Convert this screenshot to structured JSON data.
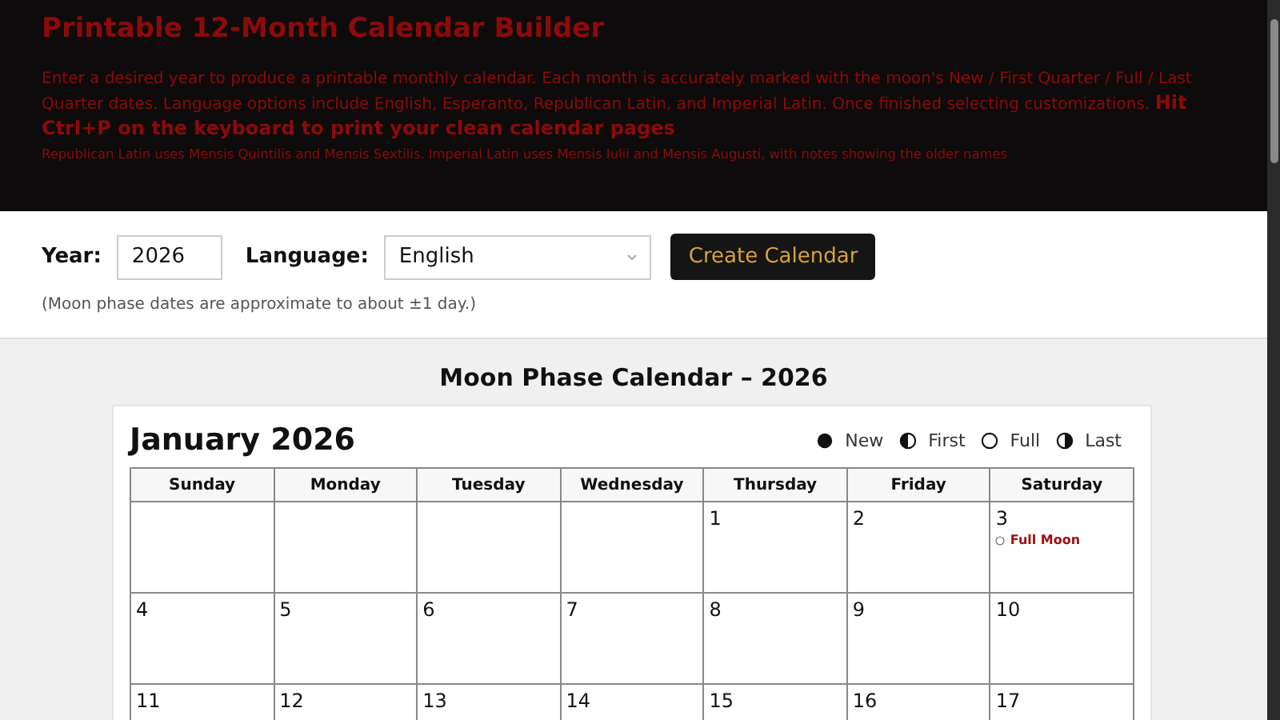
{
  "header": {
    "title": "Printable 12-Month Calendar Builder",
    "intro": "Enter a desired year to produce a printable monthly calendar. Each month is accurately marked with the moon's New / First Quarter / Full / Last Quarter dates. Language options include English, Esperanto, Republican Latin, and Imperial Latin. Once finished selecting customizations.",
    "print_hint": "Hit Ctrl+P on the keyboard to print your clean calendar pages",
    "note": "Republican Latin uses Mensis Quintilis and Mensis Sextilis. Imperial Latin uses Mensis Iulii and Mensis Augusti, with notes showing the older names"
  },
  "controls": {
    "year_label": "Year:",
    "year_value": "2026",
    "language_label": "Language:",
    "language_value": "English",
    "button": "Create Calendar",
    "disclaimer": "(Moon phase dates are approximate to about ±1 day.)"
  },
  "calendar": {
    "heading": "Moon Phase Calendar – 2026",
    "month_title": "January 2026",
    "legend": [
      {
        "kind": "new",
        "label": "New"
      },
      {
        "kind": "first",
        "label": "First"
      },
      {
        "kind": "full",
        "label": "Full"
      },
      {
        "kind": "last",
        "label": "Last"
      }
    ],
    "weekdays": [
      "Sunday",
      "Monday",
      "Tuesday",
      "Wednesday",
      "Thursday",
      "Friday",
      "Saturday"
    ],
    "weeks": [
      [
        {
          "day": "1"
        },
        {
          "day": "2"
        },
        {
          "day": "3",
          "events": [
            {
              "kind": "full",
              "label": "Full Moon"
            }
          ]
        }
      ],
      [
        {
          "day": "4"
        },
        {
          "day": "5"
        },
        {
          "day": "6"
        },
        {
          "day": "7"
        },
        {
          "day": "8"
        },
        {
          "day": "9"
        },
        {
          "day": "10"
        }
      ],
      [
        {
          "day": "11"
        },
        {
          "day": "12"
        },
        {
          "day": "13"
        },
        {
          "day": "14"
        },
        {
          "day": "15"
        },
        {
          "day": "16"
        },
        {
          "day": "17"
        }
      ]
    ]
  }
}
